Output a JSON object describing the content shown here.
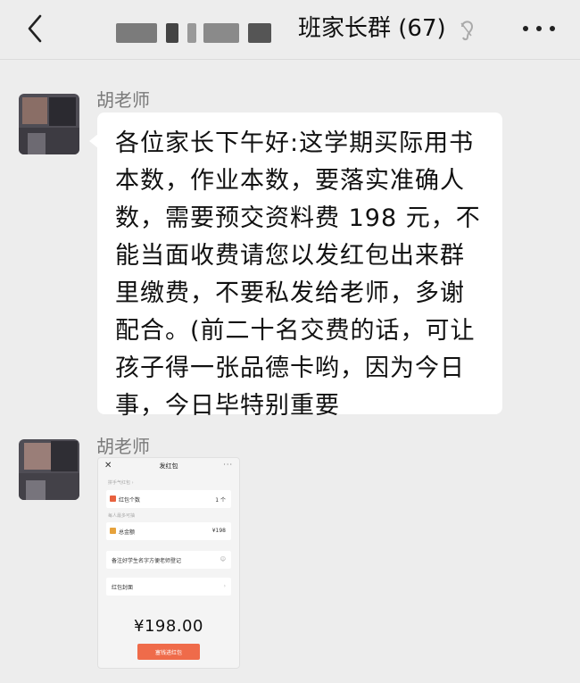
{
  "header": {
    "chat_title": "班家长群 (67)"
  },
  "messages": [
    {
      "sender": "胡老师",
      "text": "各位家长下午好:这学期买际用书\n本数，作业本数，要落实准确人\n数，需要预交资料费 198 元，不\n能当面收费请您以发红包出来群\n里缴费，不要私发给老师，多谢\n配合。(前二十名交费的话，可让\n孩子得一张品德卡哟，因为今日\n事，今日毕特别重要"
    },
    {
      "sender": "胡老师",
      "red_packet_screenshot": {
        "title": "发红包",
        "more": "···",
        "section_count_label": "拼手气红包 ›",
        "count_label": "红包个数",
        "count_value": "1 个",
        "section_amount_label": "每人最多可抽",
        "amount_label": "总金额",
        "amount_value": "¥198",
        "note_placeholder": "备注好学生名字方便老师登记",
        "cover_label": "红包封面",
        "total": "¥198.00",
        "send_button": "塞钱进红包"
      }
    }
  ],
  "colors": {
    "page_bg": "#ededed",
    "bubble_bg": "#ffffff",
    "red_button": "#ef6b4a"
  },
  "icons": [
    "back-chevron-icon",
    "ear-icon",
    "more-icon"
  ]
}
